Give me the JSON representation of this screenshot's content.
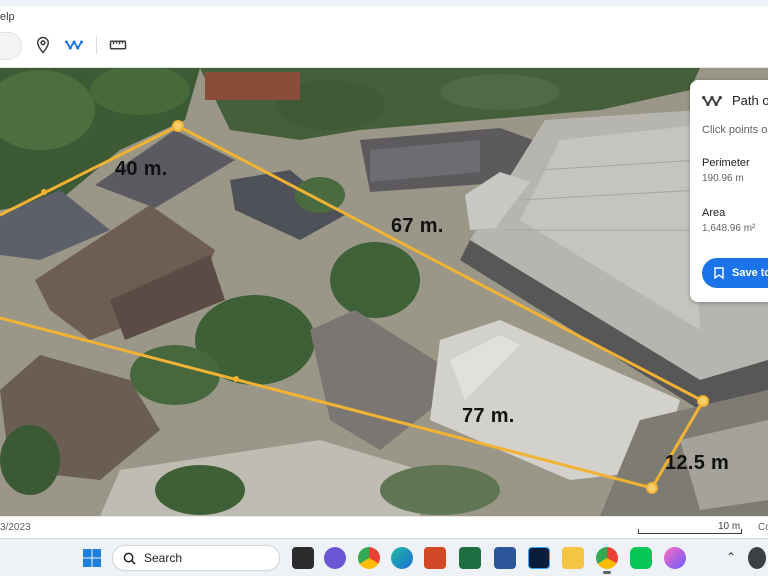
{
  "menu": {
    "help_fragment": "elp"
  },
  "toolbar": {
    "pin_tool": "map-pin-icon",
    "path_tool": "path-icon",
    "ruler_tool": "ruler-icon"
  },
  "measurements": {
    "top_edge": "40 m.",
    "upper_right_edge": "67 m.",
    "lower_edge": "77 m.",
    "right_edge": "12.5 m"
  },
  "panel": {
    "title": "Path o",
    "hint": "Click points o",
    "perimeter_label": "Perimeter",
    "perimeter_value": "190.96 m",
    "area_label": "Area",
    "area_value": "1,648.96 m²",
    "save_label": "Save to"
  },
  "status": {
    "imagery_date": "3/2023",
    "scale_label": "10 m",
    "cut_text": "Co"
  },
  "taskbar": {
    "search_label": "Search"
  },
  "colors": {
    "polygon_line": "#f2b234",
    "accent_blue": "#1a73e8",
    "panel_bg": "#ffffff"
  }
}
